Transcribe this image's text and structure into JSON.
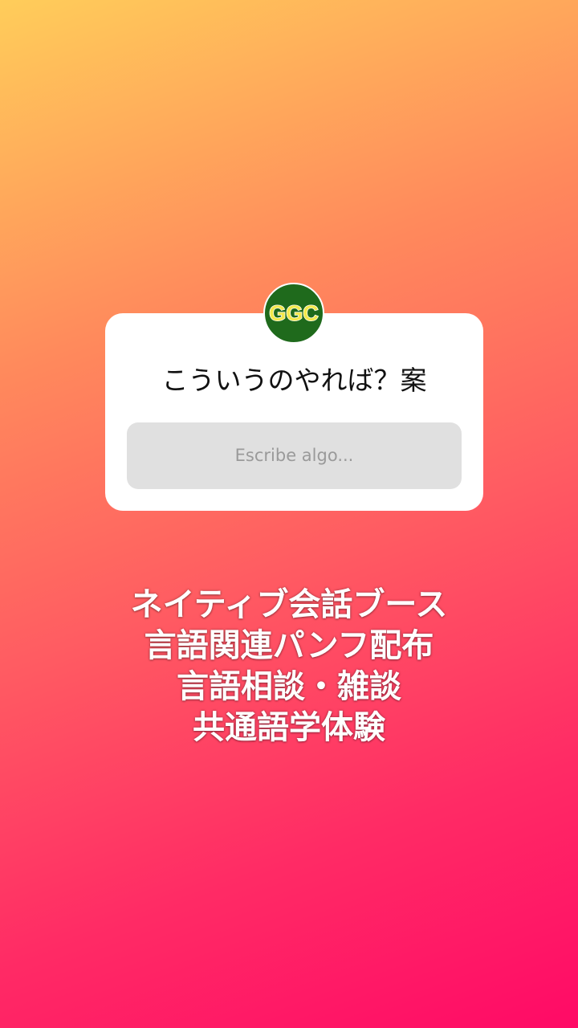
{
  "story": {
    "avatar": {
      "text": "GGC",
      "background": "#1f6a1c",
      "text_color": "#f3e94a"
    },
    "question_sticker": {
      "question": "こういうのやれば？案",
      "answer_placeholder": "Escribe algo..."
    },
    "caption_lines": [
      "ネイティブ会話ブース",
      "言語関連パンフ配布",
      "言語相談・雑談",
      "共通語学体験"
    ],
    "colors": {
      "gradient_top": "#ffcd5a",
      "gradient_bottom": "#ff0a66"
    }
  }
}
